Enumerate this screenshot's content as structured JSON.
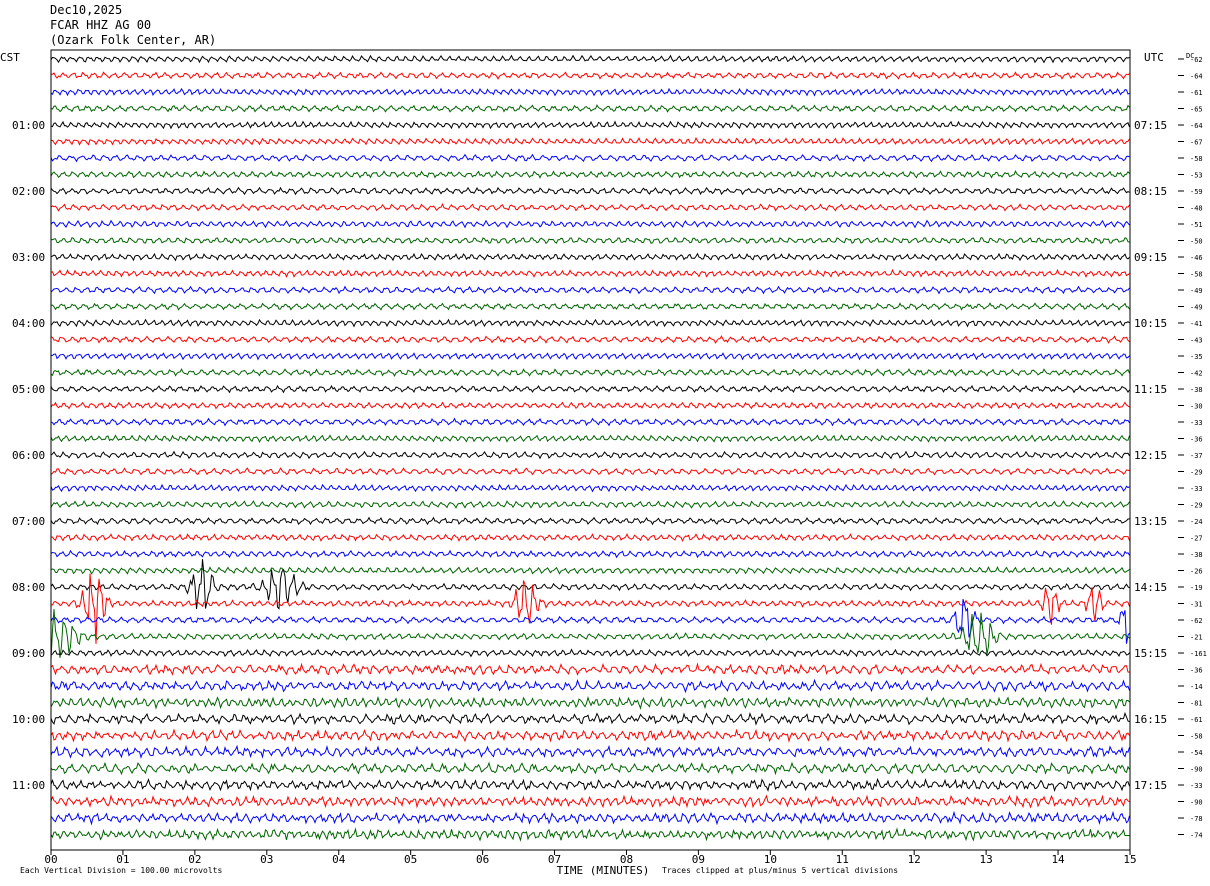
{
  "header": {
    "date": "Dec10,2025",
    "station": "FCAR HHZ AG 00",
    "location": "(Ozark Folk Center, AR)"
  },
  "footer": {
    "left_note": "Each Vertical Division =  100.00 microvolts",
    "right_note": "Traces clipped at plus/minus 5 vertical divisions"
  },
  "chart_data": {
    "type": "line",
    "xlabel": "TIME (MINUTES)",
    "x_ticks": [
      "00",
      "01",
      "02",
      "03",
      "04",
      "05",
      "06",
      "07",
      "08",
      "09",
      "10",
      "11",
      "12",
      "13",
      "14",
      "15"
    ],
    "xlim": [
      0,
      15
    ],
    "left_axis_label": "CST",
    "right_axis_label": "UTC",
    "dc_label": "DC",
    "trace_colors": [
      "#000000",
      "#ff0000",
      "#0000ff",
      "#006400"
    ],
    "left_hour_labels": [
      {
        "trace": 4,
        "label": "01:00"
      },
      {
        "trace": 8,
        "label": "02:00"
      },
      {
        "trace": 12,
        "label": "03:00"
      },
      {
        "trace": 16,
        "label": "04:00"
      },
      {
        "trace": 20,
        "label": "05:00"
      },
      {
        "trace": 24,
        "label": "06:00"
      },
      {
        "trace": 28,
        "label": "07:00"
      },
      {
        "trace": 32,
        "label": "08:00"
      },
      {
        "trace": 36,
        "label": "09:00"
      },
      {
        "trace": 40,
        "label": "10:00"
      },
      {
        "trace": 44,
        "label": "11:00"
      }
    ],
    "right_hour_labels": [
      {
        "trace": 4,
        "label": "07:15"
      },
      {
        "trace": 8,
        "label": "08:15"
      },
      {
        "trace": 12,
        "label": "09:15"
      },
      {
        "trace": 16,
        "label": "10:15"
      },
      {
        "trace": 20,
        "label": "11:15"
      },
      {
        "trace": 24,
        "label": "12:15"
      },
      {
        "trace": 28,
        "label": "13:15"
      },
      {
        "trace": 32,
        "label": "14:15"
      },
      {
        "trace": 36,
        "label": "15:15"
      },
      {
        "trace": 40,
        "label": "16:15"
      },
      {
        "trace": 44,
        "label": "17:15"
      }
    ],
    "dc_offsets": [
      "-62",
      "-64",
      "-61",
      "-65",
      "-64",
      "-67",
      "-58",
      "-53",
      "-59",
      "-48",
      "-51",
      "-50",
      "-46",
      "-58",
      "-49",
      "-49",
      "-41",
      "-43",
      "-35",
      "-42",
      "-38",
      "-30",
      "-33",
      "-36",
      "-37",
      "-29",
      "-33",
      "-29",
      "-24",
      "-27",
      "-38",
      "-26",
      "-19",
      "-31",
      "-62",
      "-21",
      "-161",
      "-36",
      "-14",
      "-81",
      "-61",
      "-58",
      "-54",
      "-90",
      "-33",
      "-90",
      "-78",
      "-74"
    ],
    "activity": [
      {
        "trace": 32,
        "x": 2.1,
        "amp": 5,
        "width": 0.15
      },
      {
        "trace": 32,
        "x": 3.2,
        "amp": 4,
        "width": 0.2
      },
      {
        "trace": 33,
        "x": 0.6,
        "amp": 6,
        "width": 0.15
      },
      {
        "trace": 33,
        "x": 6.6,
        "amp": 4,
        "width": 0.15
      },
      {
        "trace": 33,
        "x": 13.9,
        "amp": 4,
        "width": 0.1
      },
      {
        "trace": 33,
        "x": 14.5,
        "amp": 3,
        "width": 0.1
      },
      {
        "trace": 34,
        "x": 12.7,
        "amp": 5,
        "width": 0.12
      },
      {
        "trace": 34,
        "x": 15.0,
        "amp": 5,
        "width": 0.1
      },
      {
        "trace": 35,
        "x": 12.9,
        "amp": 4,
        "width": 0.2
      },
      {
        "trace": 35,
        "x": 0.1,
        "amp": 4,
        "width": 0.25
      }
    ]
  }
}
